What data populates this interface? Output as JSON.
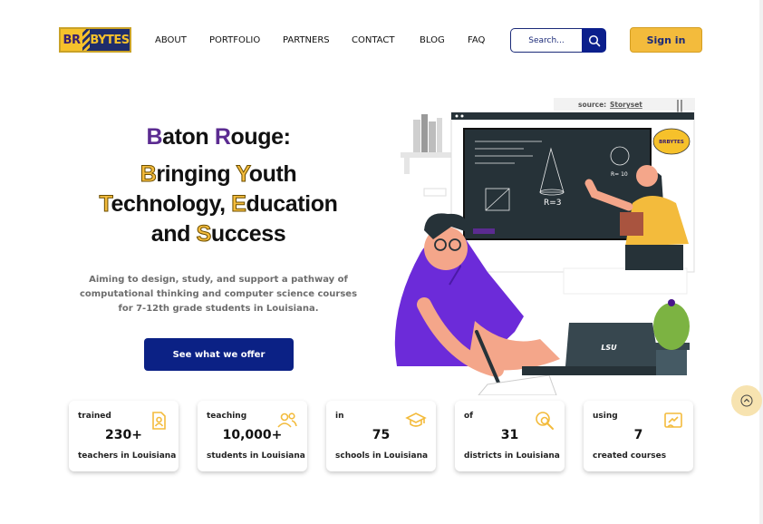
{
  "brand": {
    "logo_left": "BR",
    "logo_right": "BYTES"
  },
  "nav": {
    "items": [
      "ABOUT",
      "PORTFOLIO",
      "PARTNERS",
      "CONTACT",
      "BLOG",
      "FAQ"
    ]
  },
  "search": {
    "placeholder": "Search..."
  },
  "signin": {
    "label": "Sign in"
  },
  "hero": {
    "line1": {
      "a": "B",
      "b": "aton ",
      "c": "R",
      "d": "ouge:"
    },
    "line2": {
      "a": "B",
      "b": "ringing ",
      "c": "Y",
      "d": "outh"
    },
    "line3": {
      "a": "T",
      "b": "echnology, ",
      "c": "E",
      "d": "ducation"
    },
    "line4": {
      "a": "and ",
      "b": "S",
      "c": "uccess"
    },
    "description": "Aiming to design, study, and support a pathway of computational thinking and computer science courses for 7-12th grade students in Louisiana.",
    "cta": "See what we offer"
  },
  "illustration": {
    "source_label": "source:",
    "source_link": "Storyset",
    "badge": "BRBYTES",
    "laptop_logo": "LSU",
    "board_formula": "R=3",
    "board_formula2": "R= 10"
  },
  "stats": [
    {
      "pre": "trained",
      "value": "230+",
      "post": "teachers in Louisiana",
      "icon": "teacher-badge-icon"
    },
    {
      "pre": "teaching",
      "value": "10,000+",
      "post": "students in Louisiana",
      "icon": "users-icon"
    },
    {
      "pre": "in",
      "value": "75",
      "post": "schools in Louisiana",
      "icon": "graduation-cap-icon"
    },
    {
      "pre": "of",
      "value": "31",
      "post": "districts in Louisiana",
      "icon": "map-search-icon"
    },
    {
      "pre": "using",
      "value": "7",
      "post": "created courses",
      "icon": "presentation-icon"
    }
  ],
  "colors": {
    "accent": "#f3bb3c",
    "primary": "#0b2185",
    "purple": "#5b2b91"
  }
}
